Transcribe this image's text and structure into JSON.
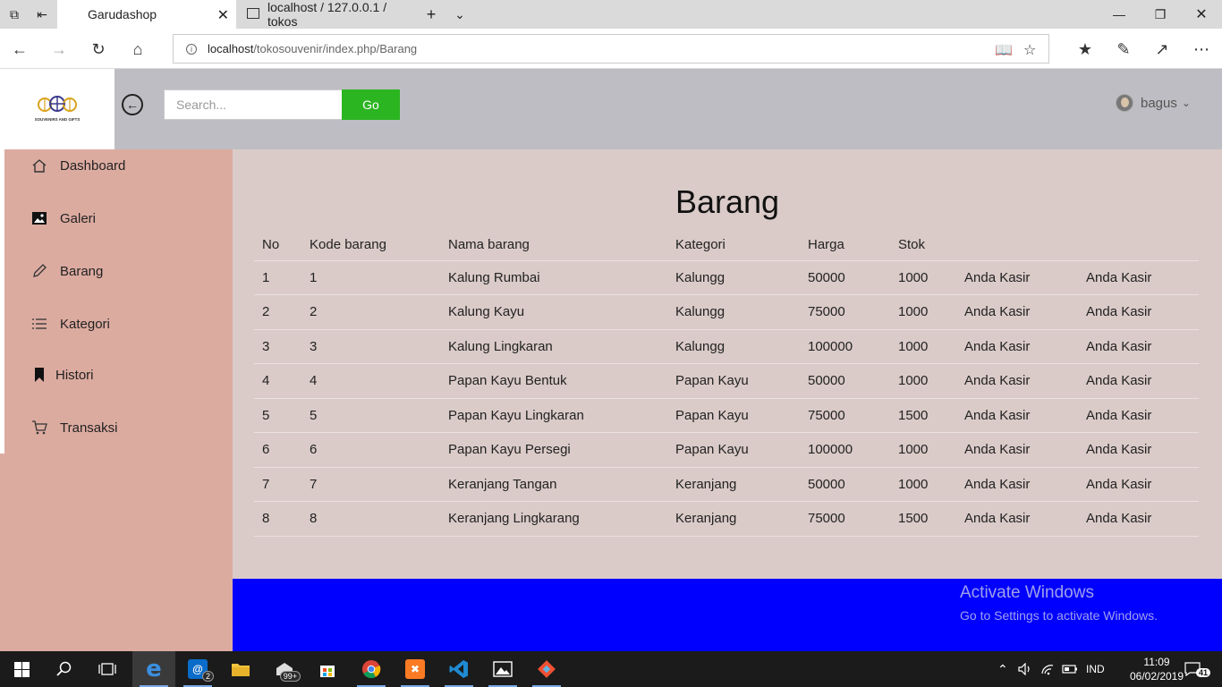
{
  "browser": {
    "tabs": [
      {
        "label": "Garudashop",
        "active": true
      },
      {
        "label": "localhost / 127.0.0.1 / tokos",
        "active": false
      }
    ],
    "url_host": "localhost",
    "url_path": "/tokosouvenir/index.php/Barang"
  },
  "header": {
    "logo_text": "SOUVENIRS AND GIFTS",
    "search_placeholder": "Search...",
    "go_label": "Go",
    "username": "bagus"
  },
  "sidebar": {
    "items": [
      {
        "label": "Dashboard",
        "icon": "home-icon"
      },
      {
        "label": "Galeri",
        "icon": "image-icon"
      },
      {
        "label": "Barang",
        "icon": "pencil-icon"
      },
      {
        "label": "Kategori",
        "icon": "list-icon"
      },
      {
        "label": "Histori",
        "icon": "bookmark-icon"
      },
      {
        "label": "Transaksi",
        "icon": "cart-icon"
      }
    ]
  },
  "main": {
    "title": "Barang",
    "columns": [
      "No",
      "Kode barang",
      "Nama barang",
      "Kategori",
      "Harga",
      "Stok",
      "",
      ""
    ],
    "rows": [
      [
        "1",
        "1",
        "Kalung Rumbai",
        "Kalungg",
        "50000",
        "1000",
        "Anda Kasir",
        "Anda Kasir"
      ],
      [
        "2",
        "2",
        "Kalung Kayu",
        "Kalungg",
        "75000",
        "1000",
        "Anda Kasir",
        "Anda Kasir"
      ],
      [
        "3",
        "3",
        "Kalung Lingkaran",
        "Kalungg",
        "100000",
        "1000",
        "Anda Kasir",
        "Anda Kasir"
      ],
      [
        "4",
        "4",
        "Papan Kayu Bentuk",
        "Papan Kayu",
        "50000",
        "1000",
        "Anda Kasir",
        "Anda Kasir"
      ],
      [
        "5",
        "5",
        "Papan Kayu Lingkaran",
        "Papan Kayu",
        "75000",
        "1500",
        "Anda Kasir",
        "Anda Kasir"
      ],
      [
        "6",
        "6",
        "Papan Kayu Persegi",
        "Papan Kayu",
        "100000",
        "1000",
        "Anda Kasir",
        "Anda Kasir"
      ],
      [
        "7",
        "7",
        "Keranjang Tangan",
        "Keranjang",
        "50000",
        "1000",
        "Anda Kasir",
        "Anda Kasir"
      ],
      [
        "8",
        "8",
        "Keranjang Lingkarang",
        "Keranjang",
        "75000",
        "1500",
        "Anda Kasir",
        "Anda Kasir"
      ]
    ]
  },
  "watermark": {
    "line1": "Activate Windows",
    "line2": "Go to Settings to activate Windows."
  },
  "taskbar": {
    "mail_badge": "2",
    "explorer_badge": "99+",
    "language": "IND",
    "time": "11:09",
    "date": "06/02/2019",
    "notifications": "41"
  },
  "colors": {
    "header_bg": "#bebdc3",
    "sidebar_bg": "#dcaba0",
    "main_bg": "#dacbc8",
    "footer_bg": "#0000ff",
    "go_button": "#2bb521"
  }
}
